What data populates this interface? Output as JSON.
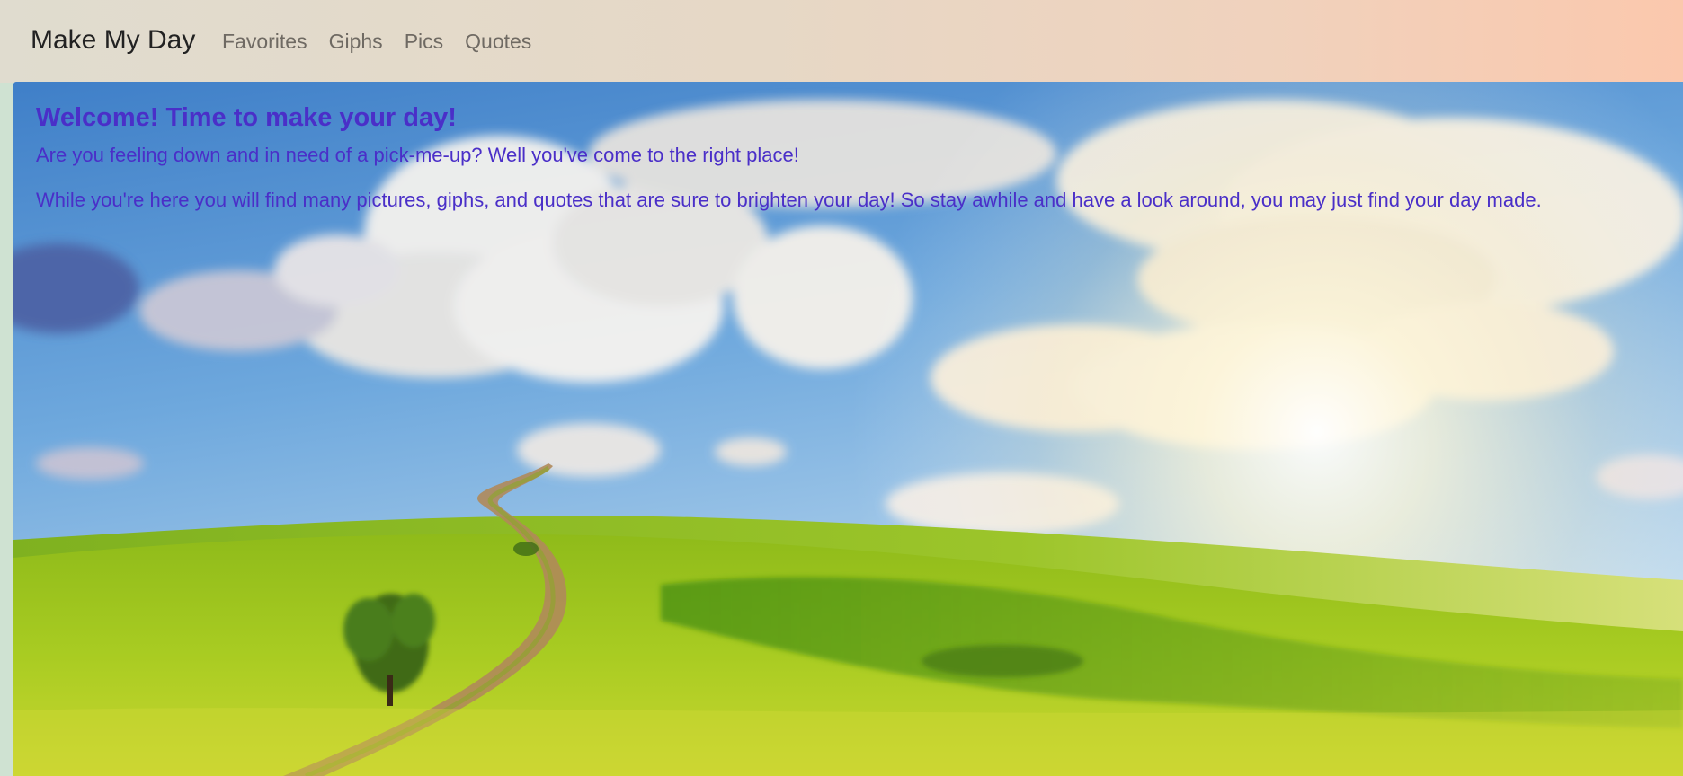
{
  "app": {
    "brand": "Make My Day"
  },
  "nav": {
    "items": [
      {
        "label": "Favorites"
      },
      {
        "label": "Giphs"
      },
      {
        "label": "Pics"
      },
      {
        "label": "Quotes"
      }
    ]
  },
  "hero": {
    "title": "Welcome! Time to make your day!",
    "paragraph1": "Are you feeling down and in need of a pick-me-up? Well you've come to the right place!",
    "paragraph2": "While you're here you will find many pictures, giphs, and quotes that are sure to brighten your day! So stay awhile and have a look around, you may just find your day made."
  },
  "colors": {
    "text_accent": "#4a2fc8",
    "brand_text": "#222222",
    "nav_text": "#6f6a63",
    "sky_top": "#4d8ccf",
    "grass": "#9cc51f"
  }
}
